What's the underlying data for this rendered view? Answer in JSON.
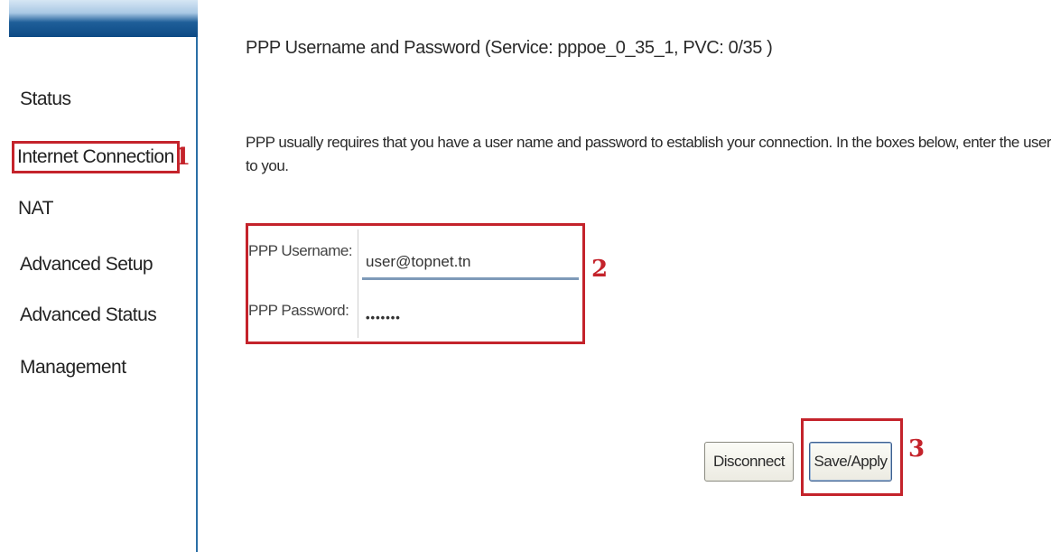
{
  "sidebar": {
    "items": [
      {
        "label": "Status"
      },
      {
        "label": "Internet Connection",
        "selected": true
      },
      {
        "label": "NAT"
      },
      {
        "label": "Advanced Setup"
      },
      {
        "label": "Advanced Status"
      },
      {
        "label": "Management"
      }
    ]
  },
  "main": {
    "title": "PPP Username and Password (Service: pppoe_0_35_1, PVC: 0/35 )",
    "description_line1": "PPP usually requires that you have a user name and password to establish your connection. In the boxes below, enter the user",
    "description_line2": "to you.",
    "fields": {
      "username_label": "PPP Username:",
      "username_value": "user@topnet.tn",
      "password_label": "PPP Password:",
      "password_value": "•••••••"
    },
    "buttons": {
      "disconnect_label": "Disconnect",
      "save_label": "Save/Apply"
    }
  },
  "annotations": {
    "marker1": "1",
    "marker2": "2",
    "marker3": "3"
  },
  "colors": {
    "annotation": "#c4232b",
    "sidebar_border": "#2b6fa6",
    "header_bar": "#0d4a85"
  }
}
